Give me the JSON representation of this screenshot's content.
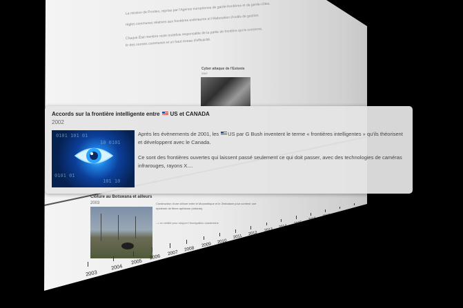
{
  "background_page": {
    "paragraphs": [
      "La mission de Frontex, reprise par l'Agence européenne de garde-frontières et de garde-côtes,",
      "règles communes relatives aux frontières extérieures et l'élaboration d'outils de gestion.",
      "Chaque État membre reste toutefois responsable de la partie de frontière qui le concerne,",
      "tir des normes communes et un haut niveau d'efficacité."
    ],
    "cyber_card": {
      "title": "Cyber attaque de l'Estonie",
      "year": "2007"
    },
    "botswana_card": {
      "title": "Cloture au Botswana et ailleurs",
      "year": "2003",
      "description": "Construction d'une clôture entre le Mozambique et le Zimbabwe pour contenir une épidémie de fièvre aphteuse (enfants).",
      "note": "--> en réalité pour stopper l'immigration clandestine"
    },
    "timeline_years": [
      "2003",
      "2004",
      "2005",
      "2006",
      "2007",
      "2008",
      "2009",
      "2010",
      "2011",
      "2012",
      "2013",
      "2014",
      "2015",
      "2016",
      "2017",
      "2018",
      "2019",
      "2020"
    ]
  },
  "popup": {
    "title_prefix": "Accords sur la frontière intelligente entre",
    "title_suffix": "US et CANADA",
    "year": "2002",
    "image_icon": "eye-icon",
    "body_p1_prefix": "Après les évènements de 2001, les",
    "body_p1_suffix": "US par G Bush inventent le terme « frontières intelligentes » qu'ils théorisent et développent avec le Canada.",
    "body_p2": "Ce sont des frontières ouvertes qui laissent passé seulement ce qui doit passer, avec des technologies de caméras infrarouges, rayons X...."
  },
  "colors": {
    "popup_bg": "#e4e4e4",
    "image_blue": "#1d7ee0",
    "background": "#000000"
  }
}
